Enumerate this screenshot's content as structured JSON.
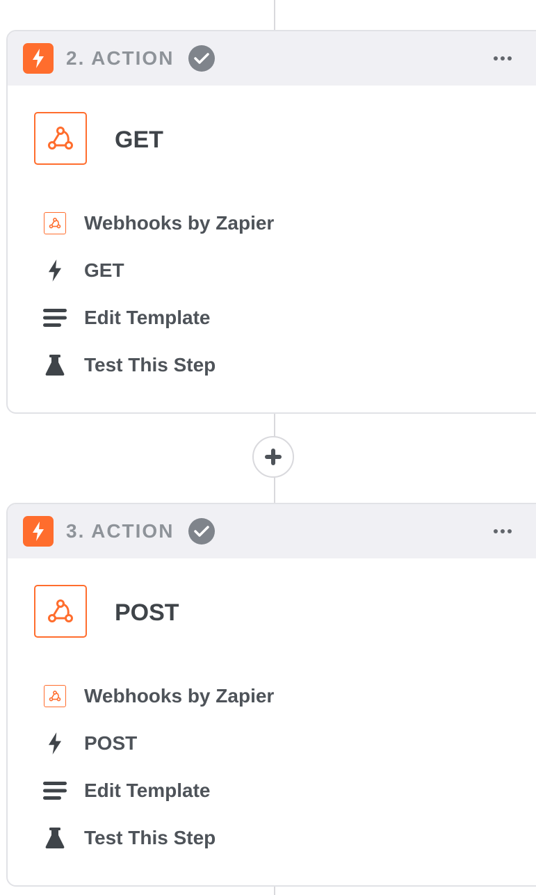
{
  "colors": {
    "accent": "#ff6d2d",
    "header_bg": "#f0f0f4",
    "check_bg": "#7f848b",
    "text": "#4e5359"
  },
  "steps": [
    {
      "label": "2. ACTION",
      "status_icon": "check-circle-icon",
      "app_icon": "webhook-icon",
      "title": "GET",
      "details": [
        {
          "icon": "webhook-icon",
          "label": "Webhooks by Zapier"
        },
        {
          "icon": "lightning-icon",
          "label": "GET"
        },
        {
          "icon": "list-icon",
          "label": "Edit Template"
        },
        {
          "icon": "flask-icon",
          "label": "Test This Step"
        }
      ]
    },
    {
      "label": "3. ACTION",
      "status_icon": "check-circle-icon",
      "app_icon": "webhook-icon",
      "title": "POST",
      "details": [
        {
          "icon": "webhook-icon",
          "label": "Webhooks by Zapier"
        },
        {
          "icon": "lightning-icon",
          "label": "POST"
        },
        {
          "icon": "list-icon",
          "label": "Edit Template"
        },
        {
          "icon": "flask-icon",
          "label": "Test This Step"
        }
      ]
    }
  ],
  "add_step_icon": "plus-icon"
}
